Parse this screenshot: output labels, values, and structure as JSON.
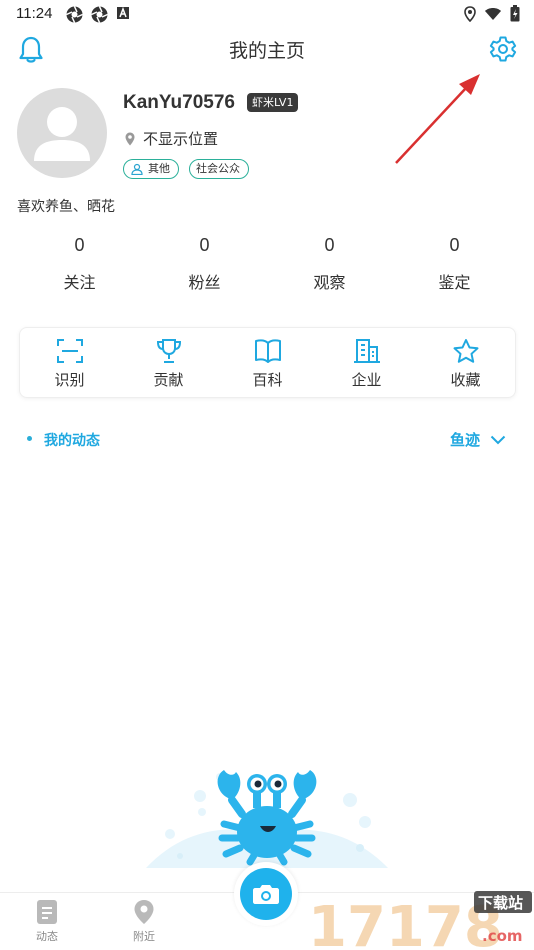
{
  "status_bar": {
    "time": "11:24",
    "icons_left": [
      "app-icon",
      "app-icon",
      "notification-icon"
    ],
    "icons_right": [
      "location-icon",
      "wifi-icon",
      "battery-icon"
    ]
  },
  "header": {
    "title": "我的主页",
    "left_icon": "bell-icon",
    "right_icon": "gear-icon"
  },
  "profile": {
    "username": "KanYu70576",
    "level": "虾米LV1",
    "location": "不显示位置",
    "tags": [
      "其他",
      "社会公众"
    ],
    "bio": "喜欢养鱼、晒花"
  },
  "stats": [
    {
      "value": "0",
      "label": "关注"
    },
    {
      "value": "0",
      "label": "粉丝"
    },
    {
      "value": "0",
      "label": "观察"
    },
    {
      "value": "0",
      "label": "鉴定"
    }
  ],
  "shortcuts": [
    {
      "label": "识别",
      "icon": "scan-icon"
    },
    {
      "label": "贡献",
      "icon": "trophy-icon"
    },
    {
      "label": "百科",
      "icon": "book-icon"
    },
    {
      "label": "企业",
      "icon": "building-icon"
    },
    {
      "label": "收藏",
      "icon": "star-icon"
    }
  ],
  "feed": {
    "title": "我的动态",
    "filter_label": "鱼迹"
  },
  "tabbar": {
    "tabs": [
      {
        "label": "动态",
        "icon": "feed-icon"
      },
      {
        "label": "附近",
        "icon": "map-pin-icon"
      }
    ],
    "center_icon": "camera-icon"
  },
  "watermark": {
    "text": "17178",
    "badge": "下载站",
    "domain": ".com"
  },
  "colors": {
    "accent": "#1fa8e0",
    "tag_border": "#2bb09a",
    "arrow": "#d93030",
    "crab": "#2cb4ec"
  }
}
